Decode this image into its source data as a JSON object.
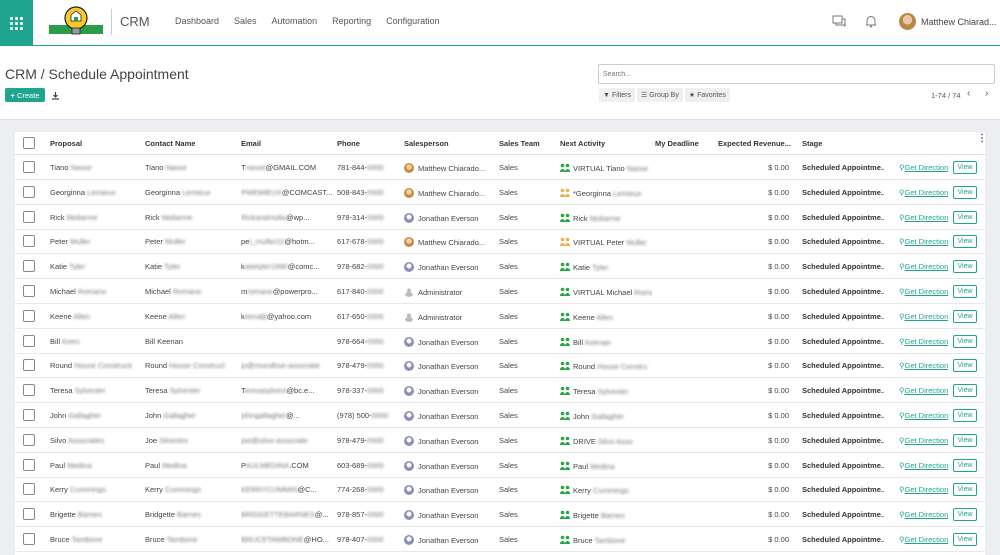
{
  "navbar": {
    "brand": "CRM",
    "menu": [
      "Dashboard",
      "Sales",
      "Automation",
      "Reporting",
      "Configuration"
    ],
    "user": "Matthew Chiarad..."
  },
  "control": {
    "breadcrumb": "CRM / Schedule Appointment",
    "create": "Create",
    "search_placeholder": "Search...",
    "filters": "Filters",
    "group_by": "Group By",
    "favorites": "Favorites",
    "pager": "1-74 / 74"
  },
  "colors": {
    "accent": "#1fa58f",
    "activity_green": "#28a745",
    "activity_orange": "#f0ad4e"
  },
  "table": {
    "headers": [
      "Proposal",
      "Contact Name",
      "Email",
      "Phone",
      "Salesperson",
      "Sales Team",
      "Next Activity",
      "My Deadline",
      "Expected Revenue...",
      "Stage"
    ],
    "rows": [
      {
        "proposal": "Tiano",
        "p_blur": "Nasse",
        "contact": "Tiano",
        "c_blur": "Nasse",
        "email_a": "T",
        "email_b": "@GMAIL.COM",
        "email_blur": "nasse",
        "phone": "781-844-",
        "phone_blur": "0000",
        "sales_av": "orange",
        "salesperson": "Matthew Chiarado...",
        "team": "Sales",
        "act_color": "green",
        "act": "VIRTUAL Tiano",
        "act_blur": "Nasse",
        "revenue": "$ 0.00",
        "stage": "Scheduled Appointme...",
        "direction": "Get Direction",
        "view": "View"
      },
      {
        "proposal": "Georginna",
        "p_blur": "Lemieux",
        "contact": "Georginna",
        "c_blur": "Lemieux",
        "email_a": "",
        "email_b": "@COMCAST...",
        "email_blur": "PWEMIEUX",
        "phone": "508-843-",
        "phone_blur": "0000",
        "sales_av": "orange",
        "salesperson": "Matthew Chiarado...",
        "team": "Sales",
        "act_color": "orange",
        "act": "*Georginna",
        "act_blur": "Lemieux",
        "revenue": "$ 0.00",
        "stage": "Scheduled Appointme...",
        "direction": "Get Direction",
        "view": "View"
      },
      {
        "proposal": "Rick",
        "p_blur": "Moliarme",
        "contact": "Rick",
        "c_blur": "Moliarme",
        "email_a": "",
        "email_b": "@wp...",
        "email_blur": "Rickandmolia",
        "phone": "978-314-",
        "phone_blur": "0000",
        "sales_av": "purple",
        "salesperson": "Jonathan Everson",
        "team": "Sales",
        "act_color": "green",
        "act": "Rick",
        "act_blur": "Moliarme",
        "revenue": "$ 0.00",
        "stage": "Scheduled Appointme...",
        "direction": "Get Direction",
        "view": "View"
      },
      {
        "proposal": "Peter",
        "p_blur": "Muller",
        "contact": "Peter",
        "c_blur": "Muller",
        "email_a": "pe",
        "email_b": "@hotm...",
        "email_blur": "t_muller22",
        "phone": "617-678-",
        "phone_blur": "0000",
        "sales_av": "orange",
        "salesperson": "Matthew Chiarado...",
        "team": "Sales",
        "act_color": "orange",
        "act": "VIRTUAL Peter",
        "act_blur": "Muller",
        "revenue": "$ 0.00",
        "stage": "Scheduled Appointme...",
        "direction": "Get Direction",
        "view": "View"
      },
      {
        "proposal": "Katie",
        "p_blur": "Tyler",
        "contact": "Katie",
        "c_blur": "Tyler",
        "email_a": "k",
        "email_b": "@comc...",
        "email_blur": "atietyler1990",
        "phone": "978-682-",
        "phone_blur": "0000",
        "sales_av": "purple",
        "salesperson": "Jonathan Everson",
        "team": "Sales",
        "act_color": "green",
        "act": "Katie",
        "act_blur": "Tyler",
        "revenue": "$ 0.00",
        "stage": "Scheduled Appointme...",
        "direction": "Get Direction",
        "view": "View"
      },
      {
        "proposal": "Michael",
        "p_blur": "Romano",
        "contact": "Michael",
        "c_blur": "Romano",
        "email_a": "m",
        "email_b": "@powerpro...",
        "email_blur": "romano",
        "phone": "617-840-",
        "phone_blur": "0000",
        "sales_av": "grey",
        "salesperson": "Administrator",
        "team": "Sales",
        "act_color": "green",
        "act": "VIRTUAL Michael",
        "act_blur": "Romano",
        "revenue": "$ 0.00",
        "stage": "Scheduled Appointme...",
        "direction": "Get Direction",
        "view": "View"
      },
      {
        "proposal": "Keene",
        "p_blur": "Allen",
        "contact": "Keene",
        "c_blur": "Allen",
        "email_a": "k",
        "email_b": "@yahoo.com",
        "email_blur": "eenaljt",
        "phone": "617-650-",
        "phone_blur": "0000",
        "sales_av": "grey",
        "salesperson": "Administrator",
        "team": "Sales",
        "act_color": "green",
        "act": "Keene",
        "act_blur": "Allen",
        "revenue": "$ 0.00",
        "stage": "Scheduled Appointme...",
        "direction": "Get Direction",
        "view": "View"
      },
      {
        "proposal": "Bill",
        "p_blur": "Keen",
        "contact": "Bill Keenan",
        "c_blur": "",
        "email_a": "",
        "email_b": "",
        "email_blur": "",
        "phone": "978-664-",
        "phone_blur": "0000",
        "sales_av": "purple",
        "salesperson": "Jonathan Everson",
        "team": "Sales",
        "act_color": "green",
        "act": "Bill",
        "act_blur": "Keenan",
        "revenue": "$ 0.00",
        "stage": "Scheduled Appointme...",
        "direction": "Get Direction",
        "view": "View"
      },
      {
        "proposal": "Round",
        "p_blur": "House Constructi",
        "contact": "Round",
        "c_blur": "House Construct",
        "email_a": "",
        "email_b": "",
        "email_blur": "jo@roundhse-associate",
        "phone": "978-479-",
        "phone_blur": "0000",
        "sales_av": "purple",
        "salesperson": "Jonathan Everson",
        "team": "Sales",
        "act_color": "green",
        "act": "Round",
        "act_blur": "House Constru",
        "revenue": "$ 0.00",
        "stage": "Scheduled Appointme...",
        "direction": "Get Direction",
        "view": "View"
      },
      {
        "proposal": "Teresa",
        "p_blur": "Sylvester",
        "contact": "Teresa",
        "c_blur": "Sylvester",
        "email_a": "T",
        "email_b": "@bc.e...",
        "email_blur": "eresasylvest",
        "phone": "978-337-",
        "phone_blur": "0000",
        "sales_av": "purple",
        "salesperson": "Jonathan Everson",
        "team": "Sales",
        "act_color": "green",
        "act": "Teresa",
        "act_blur": "Sylvester",
        "revenue": "$ 0.00",
        "stage": "Scheduled Appointme...",
        "direction": "Get Direction",
        "view": "View"
      },
      {
        "proposal": "John",
        "p_blur": "Gallagher",
        "contact": "John",
        "c_blur": "Gallagher",
        "email_a": "",
        "email_b": "@...",
        "email_blur": "johngallagher",
        "phone": "(978) 500-",
        "phone_blur": "0000",
        "sales_av": "purple",
        "salesperson": "Jonathan Everson",
        "team": "Sales",
        "act_color": "green",
        "act": "John",
        "act_blur": "Gallagher",
        "revenue": "$ 0.00",
        "stage": "Scheduled Appointme...",
        "direction": "Get Direction",
        "view": "View"
      },
      {
        "proposal": "Silvo",
        "p_blur": "Associates",
        "contact": "Joe",
        "c_blur": "Silvestro",
        "email_a": "",
        "email_b": "",
        "email_blur": "joe@silvo-associate",
        "phone": "978-479-",
        "phone_blur": "0000",
        "sales_av": "purple",
        "salesperson": "Jonathan Everson",
        "team": "Sales",
        "act_color": "green",
        "act": "DRIVE",
        "act_blur": "Silvo Asso",
        "revenue": "$ 0.00",
        "stage": "Scheduled Appointme...",
        "direction": "Get Direction",
        "view": "View"
      },
      {
        "proposal": "Paul",
        "p_blur": "Medina",
        "contact": "Paul",
        "c_blur": "Medina",
        "email_a": "P",
        "email_b": ".COM",
        "email_blur": "AULMEDINA",
        "phone": "603-689-",
        "phone_blur": "0000",
        "sales_av": "purple",
        "salesperson": "Jonathan Everson",
        "team": "Sales",
        "act_color": "green",
        "act": "Paul",
        "act_blur": "Medina",
        "revenue": "$ 0.00",
        "stage": "Scheduled Appointme...",
        "direction": "Get Direction",
        "view": "View"
      },
      {
        "proposal": "Kerry",
        "p_blur": "Cummings",
        "contact": "Kerry",
        "c_blur": "Cummings",
        "email_a": "",
        "email_b": "@C...",
        "email_blur": "KERRYCUMMIN",
        "phone": "774-268-",
        "phone_blur": "0000",
        "sales_av": "purple",
        "salesperson": "Jonathan Everson",
        "team": "Sales",
        "act_color": "green",
        "act": "Kerry",
        "act_blur": "Cummings",
        "revenue": "$ 0.00",
        "stage": "Scheduled Appointme...",
        "direction": "Get Direction",
        "view": "View"
      },
      {
        "proposal": "Brigette",
        "p_blur": "Barnes",
        "contact": "Bridgette",
        "c_blur": "Barnes",
        "email_a": "",
        "email_b": "@...",
        "email_blur": "BRIDGETTEBARNES",
        "phone": "978-857-",
        "phone_blur": "0000",
        "sales_av": "purple",
        "salesperson": "Jonathan Everson",
        "team": "Sales",
        "act_color": "green",
        "act": "Brigette",
        "act_blur": "Barnes",
        "revenue": "$ 0.00",
        "stage": "Scheduled Appointme...",
        "direction": "Get Direction",
        "view": "View"
      },
      {
        "proposal": "Bruce",
        "p_blur": "Tambone",
        "contact": "Bruce",
        "c_blur": "Tambone",
        "email_a": "",
        "email_b": "@HO...",
        "email_blur": "BRUCETAMBONE",
        "phone": "978-407-",
        "phone_blur": "0000",
        "sales_av": "purple",
        "salesperson": "Jonathan Everson",
        "team": "Sales",
        "act_color": "green",
        "act": "Bruce",
        "act_blur": "Tambone",
        "revenue": "$ 0.00",
        "stage": "Scheduled Appointme...",
        "direction": "Get Direction",
        "view": "View"
      }
    ]
  }
}
